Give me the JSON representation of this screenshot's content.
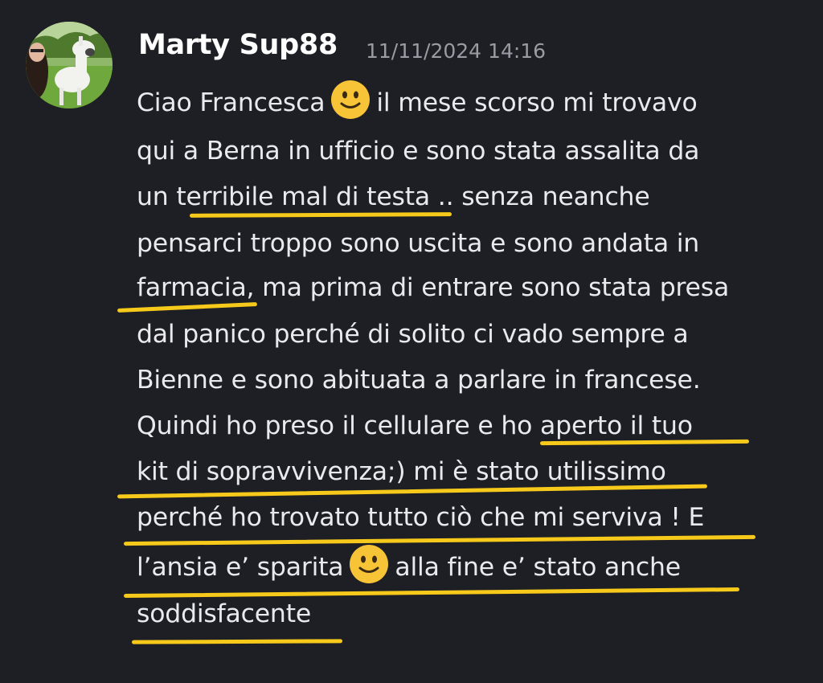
{
  "message": {
    "author": "Marty Sup88",
    "timestamp": "11/11/2024 14:16",
    "avatar_icon": "avatar-woman-with-llama",
    "emoji_icon": "slightly-smiling-face",
    "highlight_color": "#f6c91a",
    "lines": [
      {
        "pre": "Ciao Francesca",
        "post": "il mese scorso mi trovavo"
      },
      {
        "text": "qui a Berna in ufficio e sono stata assalita da"
      },
      {
        "text": "un terribile mal di testa .. senza neanche"
      },
      {
        "text": "pensarci troppo sono uscita e sono andata in"
      },
      {
        "text": "farmacia, ma prima di entrare sono stata presa"
      },
      {
        "text": "dal panico perché di solito ci vado sempre a"
      },
      {
        "text": "Bienne e sono abituata a parlare in francese."
      },
      {
        "text": "Quindi ho preso il cellulare e ho aperto il tuo"
      },
      {
        "text": "kit di sopravvivenza;) mi è stato utilissimo"
      },
      {
        "text": "perché ho trovato tutto ciò che mi serviva ! E"
      },
      {
        "pre": "l’ansia e’ sparita",
        "post": "alla fine e’ stato anche"
      },
      {
        "text": "soddisfacente"
      }
    ]
  }
}
